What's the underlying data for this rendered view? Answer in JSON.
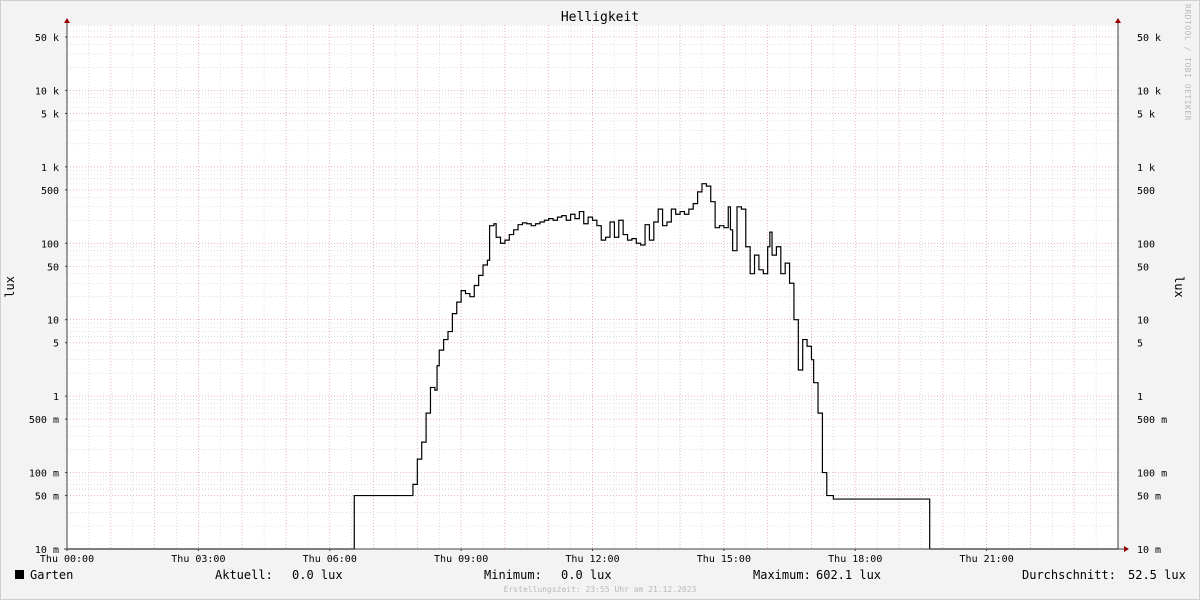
{
  "watermark": "RRDTOOL / TOBI OETIKER",
  "legend": {
    "series": "Garten",
    "current_label": "Aktuell:",
    "current_value": "0.0 lux",
    "min_label": "Minimum:",
    "min_value": "0.0 lux",
    "max_label": "Maximum:",
    "max_value": "602.1 lux",
    "avg_label": "Durchschnitt:",
    "avg_value": "52.5 lux"
  },
  "footer": "Erstellungszeit: 23:55 Uhr am 21.12.2023",
  "colors": {
    "line": "#000000",
    "major_grid": "#e8a0a0",
    "minor_grid": "#cccccc",
    "axis": "#404040",
    "arrow": "#990000"
  },
  "chart_data": {
    "type": "line",
    "title": "Helligkeit",
    "ylabel": "lux",
    "xlabel": "",
    "y_scale": "log",
    "ylim": [
      0.01,
      80000
    ],
    "xlim_hours": [
      0,
      24
    ],
    "x_ticks": [
      {
        "h": 0,
        "label": "Thu 00:00"
      },
      {
        "h": 3,
        "label": "Thu 03:00"
      },
      {
        "h": 6,
        "label": "Thu 06:00"
      },
      {
        "h": 9,
        "label": "Thu 09:00"
      },
      {
        "h": 12,
        "label": "Thu 12:00"
      },
      {
        "h": 15,
        "label": "Thu 15:00"
      },
      {
        "h": 18,
        "label": "Thu 18:00"
      },
      {
        "h": 21,
        "label": "Thu 21:00"
      }
    ],
    "y_ticks": [
      {
        "v": 0.01,
        "label": "10 m"
      },
      {
        "v": 0.05,
        "label": "50 m"
      },
      {
        "v": 0.1,
        "label": "100 m"
      },
      {
        "v": 0.5,
        "label": "500 m"
      },
      {
        "v": 1,
        "label": "1"
      },
      {
        "v": 5,
        "label": "5"
      },
      {
        "v": 10,
        "label": "10"
      },
      {
        "v": 50,
        "label": "50"
      },
      {
        "v": 100,
        "label": "100"
      },
      {
        "v": 500,
        "label": "500"
      },
      {
        "v": 1000,
        "label": "1 k"
      },
      {
        "v": 5000,
        "label": "5 k"
      },
      {
        "v": 10000,
        "label": "10 k"
      },
      {
        "v": 50000,
        "label": "50 k"
      }
    ],
    "series": [
      {
        "name": "Garten",
        "points": [
          [
            0,
            0.01
          ],
          [
            6.55,
            0.01
          ],
          [
            6.56,
            0.05
          ],
          [
            7.88,
            0.05
          ],
          [
            7.9,
            0.07
          ],
          [
            8.0,
            0.15
          ],
          [
            8.1,
            0.25
          ],
          [
            8.2,
            0.6
          ],
          [
            8.3,
            1.3
          ],
          [
            8.4,
            1.2
          ],
          [
            8.45,
            2.5
          ],
          [
            8.5,
            4
          ],
          [
            8.6,
            5.5
          ],
          [
            8.7,
            7
          ],
          [
            8.8,
            12
          ],
          [
            8.9,
            17
          ],
          [
            9.0,
            24
          ],
          [
            9.1,
            22
          ],
          [
            9.2,
            20
          ],
          [
            9.3,
            28
          ],
          [
            9.4,
            38
          ],
          [
            9.5,
            52
          ],
          [
            9.6,
            60
          ],
          [
            9.65,
            170
          ],
          [
            9.75,
            180
          ],
          [
            9.8,
            120
          ],
          [
            9.9,
            100
          ],
          [
            10.0,
            110
          ],
          [
            10.1,
            130
          ],
          [
            10.2,
            150
          ],
          [
            10.3,
            175
          ],
          [
            10.4,
            185
          ],
          [
            10.5,
            180
          ],
          [
            10.6,
            170
          ],
          [
            10.7,
            180
          ],
          [
            10.8,
            190
          ],
          [
            10.9,
            200
          ],
          [
            11.0,
            210
          ],
          [
            11.1,
            200
          ],
          [
            11.2,
            220
          ],
          [
            11.3,
            230
          ],
          [
            11.4,
            200
          ],
          [
            11.5,
            240
          ],
          [
            11.6,
            210
          ],
          [
            11.7,
            260
          ],
          [
            11.8,
            180
          ],
          [
            11.9,
            220
          ],
          [
            12.0,
            200
          ],
          [
            12.1,
            170
          ],
          [
            12.2,
            110
          ],
          [
            12.3,
            120
          ],
          [
            12.4,
            190
          ],
          [
            12.5,
            120
          ],
          [
            12.6,
            200
          ],
          [
            12.7,
            130
          ],
          [
            12.8,
            110
          ],
          [
            12.9,
            115
          ],
          [
            13.0,
            100
          ],
          [
            13.1,
            95
          ],
          [
            13.2,
            175
          ],
          [
            13.3,
            110
          ],
          [
            13.4,
            190
          ],
          [
            13.5,
            280
          ],
          [
            13.6,
            170
          ],
          [
            13.7,
            190
          ],
          [
            13.8,
            280
          ],
          [
            13.9,
            240
          ],
          [
            14.0,
            260
          ],
          [
            14.1,
            240
          ],
          [
            14.2,
            280
          ],
          [
            14.3,
            330
          ],
          [
            14.4,
            470
          ],
          [
            14.5,
            602.1
          ],
          [
            14.6,
            560
          ],
          [
            14.7,
            350
          ],
          [
            14.8,
            160
          ],
          [
            14.9,
            170
          ],
          [
            15.0,
            160
          ],
          [
            15.1,
            300
          ],
          [
            15.15,
            150
          ],
          [
            15.2,
            80
          ],
          [
            15.3,
            300
          ],
          [
            15.4,
            280
          ],
          [
            15.5,
            90
          ],
          [
            15.6,
            40
          ],
          [
            15.7,
            70
          ],
          [
            15.8,
            45
          ],
          [
            15.9,
            40
          ],
          [
            16.0,
            90
          ],
          [
            16.05,
            140
          ],
          [
            16.1,
            70
          ],
          [
            16.2,
            90
          ],
          [
            16.3,
            40
          ],
          [
            16.4,
            55
          ],
          [
            16.5,
            30
          ],
          [
            16.6,
            10
          ],
          [
            16.7,
            2.2
          ],
          [
            16.8,
            5.5
          ],
          [
            16.9,
            4.5
          ],
          [
            17.0,
            3
          ],
          [
            17.05,
            1.5
          ],
          [
            17.15,
            0.6
          ],
          [
            17.25,
            0.1
          ],
          [
            17.35,
            0.05
          ],
          [
            17.5,
            0.045
          ],
          [
            19.6,
            0.045
          ],
          [
            19.7,
            0.01
          ],
          [
            24,
            0.01
          ]
        ]
      }
    ]
  }
}
